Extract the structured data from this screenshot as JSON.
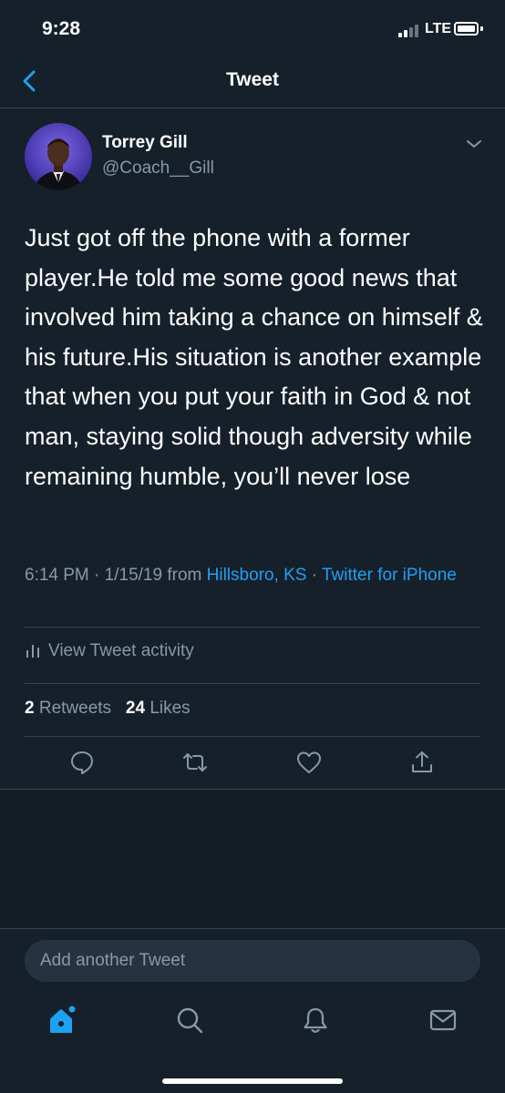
{
  "status_bar": {
    "time": "9:28",
    "network": "LTE"
  },
  "header": {
    "title": "Tweet",
    "back_icon": "chevron-left-icon"
  },
  "author": {
    "name": "Torrey Gill",
    "handle": "@Coach__Gill"
  },
  "tweet": {
    "text": "Just got off the phone with a former player.He told me some good news that involved him taking a chance on himself & his future.His situation is another example that when you put your faith in God & not man, staying solid though adversity while remaining humble, you’ll never lose",
    "time": "6:14 PM",
    "date": "1/15/19",
    "from_label": "from",
    "location": "Hillsboro, KS",
    "source": "Twitter for iPhone",
    "separator": "·"
  },
  "activity": {
    "label": "View Tweet activity"
  },
  "stats": {
    "retweets_count": "2",
    "retweets_label": "Retweets",
    "likes_count": "24",
    "likes_label": "Likes"
  },
  "actions": [
    "reply-icon",
    "retweet-icon",
    "like-icon",
    "share-icon"
  ],
  "compose": {
    "placeholder": "Add another Tweet"
  },
  "tab_bar": [
    "home-icon",
    "search-icon",
    "notifications-icon",
    "messages-icon"
  ],
  "colors": {
    "background": "#15202b",
    "accent": "#1da1f2",
    "secondary_text": "#8899a6",
    "divider": "#38444d"
  }
}
